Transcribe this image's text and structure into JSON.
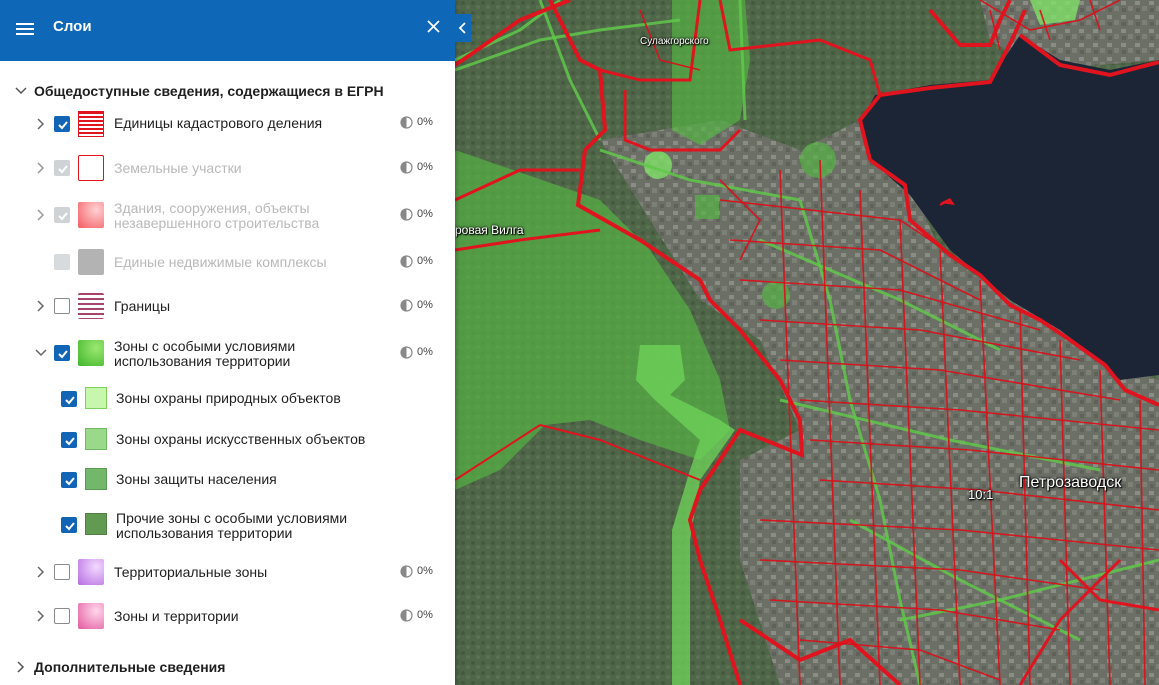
{
  "panel": {
    "title": "Слои",
    "sections": [
      {
        "title": "Общедоступные сведения, содержащиеся в ЕГРН"
      },
      {
        "title": "Дополнительные сведения"
      }
    ],
    "layers": [
      {
        "label": "Единицы кадастрового деления",
        "opacity": "0%",
        "checked": true
      },
      {
        "label": "Земельные участки",
        "opacity": "0%",
        "checked": true
      },
      {
        "label_line1": "Здания, сооружения, объекты",
        "label_line2": "незавершенного строительства",
        "opacity": "0%",
        "checked": true
      },
      {
        "label": "Единые недвижимые комплексы",
        "opacity": "0%",
        "checked": false
      },
      {
        "label": "Границы",
        "opacity": "0%",
        "checked": false
      },
      {
        "label_line1": "Зоны с особыми условиями",
        "label_line2": "использования территории",
        "opacity": "0%",
        "checked": true
      },
      {
        "label": "Территориальные зоны",
        "opacity": "0%",
        "checked": false
      },
      {
        "label": "Зоны и территории",
        "opacity": "0%",
        "checked": false
      }
    ],
    "sublayers": [
      {
        "label": "Зоны охраны природных объектов",
        "checked": true
      },
      {
        "label": "Зоны охраны искусственных объектов",
        "checked": true
      },
      {
        "label": "Зоны защиты населения",
        "checked": true
      },
      {
        "label_line1": "Прочие зоны с особыми условиями",
        "label_line2": "использования территории",
        "checked": true
      }
    ]
  },
  "map": {
    "labels": {
      "sulazhgorskogo": "Сулажгорского",
      "vilga": "ровая Вилга",
      "petrozavodsk": "Петрозаводск",
      "zoom_hint": "10:1"
    }
  },
  "colors": {
    "header": "#0f67b8",
    "accent": "#1265b5",
    "boundary": "#e0141e",
    "zone_green": "#5fc24a",
    "lake": "#1c2535"
  }
}
